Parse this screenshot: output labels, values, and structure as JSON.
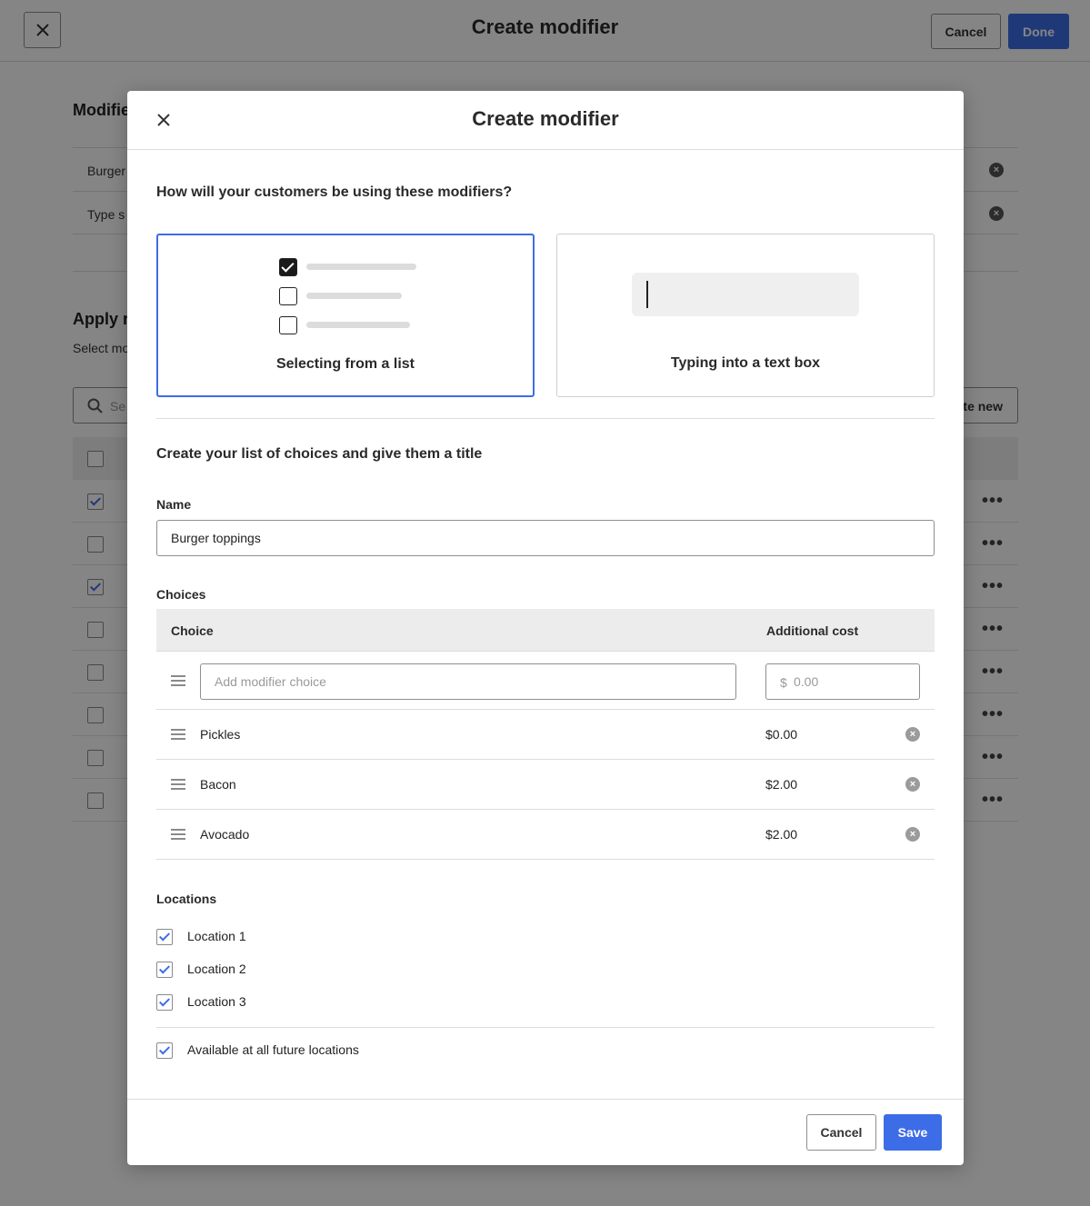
{
  "topbar": {
    "title": "Create modifier",
    "cancel_label": "Cancel",
    "done_label": "Done"
  },
  "background": {
    "section1_heading": "Modifie",
    "rows": [
      "Burger",
      "Type s"
    ],
    "section2_heading": "Apply r",
    "section2_sub": "Select mo",
    "search_placeholder": "Se",
    "create_new_label": "te new",
    "table_rows_checked": [
      true,
      false,
      true,
      false,
      false,
      false,
      false,
      false
    ]
  },
  "modal": {
    "title": "Create modifier",
    "question": "How will your customers be using these modifiers?",
    "options": [
      {
        "label": "Selecting from a list",
        "selected": true
      },
      {
        "label": "Typing into a text box",
        "selected": false
      }
    ],
    "section_title": "Create your list of choices and give them a title",
    "name_label": "Name",
    "name_value": "Burger toppings",
    "choices_label": "Choices",
    "choices_table": {
      "headers": {
        "choice": "Choice",
        "cost": "Additional cost"
      },
      "add_placeholder": "Add modifier choice",
      "currency_symbol": "$",
      "cost_placeholder": "0.00",
      "rows": [
        {
          "name": "Pickles",
          "cost": "$0.00"
        },
        {
          "name": "Bacon",
          "cost": "$2.00"
        },
        {
          "name": "Avocado",
          "cost": "$2.00"
        }
      ]
    },
    "locations_label": "Locations",
    "locations": [
      {
        "label": "Location 1",
        "checked": true
      },
      {
        "label": "Location 2",
        "checked": true
      },
      {
        "label": "Location 3",
        "checked": true
      }
    ],
    "future_locations": {
      "label": "Available at all future locations",
      "checked": true
    },
    "cancel_label": "Cancel",
    "save_label": "Save"
  },
  "colors": {
    "accent": "#3d6de6",
    "overlay": "rgba(0,0,0,0.48)"
  },
  "icons": [
    "close-icon",
    "search-icon",
    "remove-circle-icon",
    "drag-handle-icon",
    "more-icon"
  ]
}
